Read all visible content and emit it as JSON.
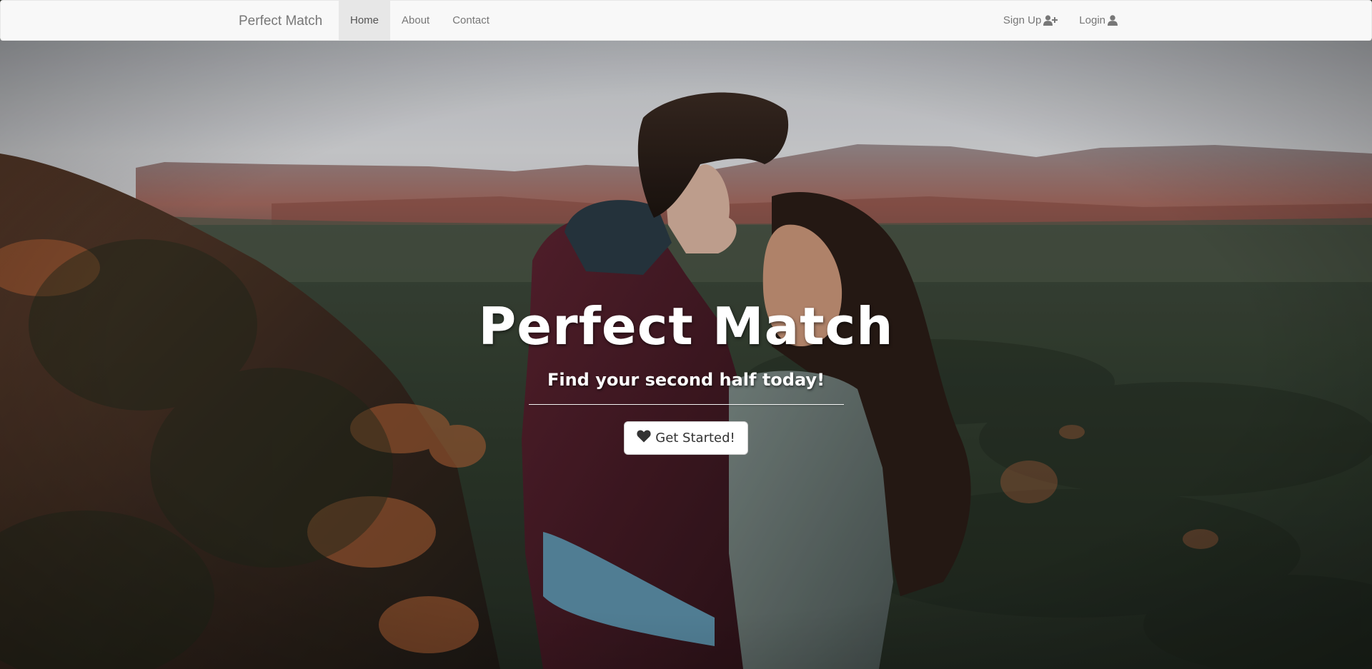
{
  "navbar": {
    "brand": "Perfect Match",
    "links": [
      {
        "label": "Home",
        "active": true
      },
      {
        "label": "About",
        "active": false
      },
      {
        "label": "Contact",
        "active": false
      }
    ],
    "right_links": [
      {
        "label": "Sign Up",
        "icon": "user-plus-icon"
      },
      {
        "label": "Login",
        "icon": "user-icon"
      }
    ]
  },
  "hero": {
    "background_image": "couple-on-mountain-photo",
    "title": "Perfect Match",
    "subtitle": "Find your second half today!",
    "cta": {
      "label": "Get Started!",
      "icon": "heart-icon"
    }
  },
  "colors": {
    "navbar_bg": "#f8f8f8",
    "navbar_text": "#777777",
    "navbar_active_bg": "#e7e7e7",
    "hero_text": "#ffffff",
    "button_bg": "#ffffff",
    "button_text": "#333333"
  }
}
